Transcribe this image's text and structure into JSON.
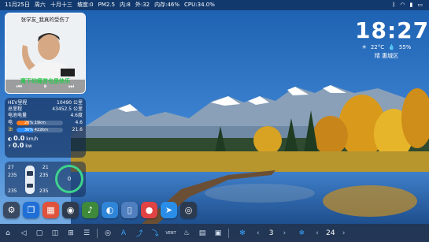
{
  "status_bar": {
    "date": "11月25日",
    "weekday": "周六",
    "lunar": "十月十三",
    "slope": "坡度:0",
    "pm25": "PM2.5",
    "inside": "内:8",
    "outside": "外:32",
    "memory": "内存:46%",
    "cpu": "CPU:34.0%",
    "icons": [
      "bluetooth-icon",
      "wifi-icon",
      "signal-icon",
      "battery-icon"
    ]
  },
  "clock": {
    "time": "18:27",
    "temperature": "22°C",
    "humidity": "55%",
    "location": "晴 惠城区"
  },
  "music": {
    "song_title": "张学友_我真的受伤了",
    "lyric": "离下的痛苦也是快乐",
    "controls": [
      "previous-icon",
      "pause-icon",
      "next-icon"
    ]
  },
  "vehicle": {
    "rows": [
      {
        "label": "HEV里程",
        "value": "10490 公里"
      },
      {
        "label": "总里程",
        "value": "43452.5 公里"
      },
      {
        "label": "电池电量",
        "value": "4.6度"
      }
    ],
    "electric": {
      "label": "电",
      "percent_text": "26% 19km",
      "percent": 26,
      "value": "4.6"
    },
    "fuel": {
      "label": "油",
      "percent_text": "36% 422km",
      "percent": 36,
      "value": "21.6"
    },
    "speed_label": "0.0",
    "speed_unit": "km/h",
    "energy_label": "0.0",
    "energy_unit": "kw",
    "accent_electric": "#ff7a1a",
    "accent_fuel": "#2b8cff"
  },
  "tires": {
    "front_left": "235",
    "front_right": "235",
    "rear_left": "235",
    "rear_right": "235",
    "temp_fl": "27",
    "temp_fr": "21",
    "gauge_value": "0",
    "gauge_color": "#3dd28c"
  },
  "dock": {
    "apps": [
      {
        "name": "settings-app",
        "glyph": "⚙",
        "color": "#3a4a63"
      },
      {
        "name": "copy-app",
        "glyph": "❐",
        "color": "#1f6fd6"
      },
      {
        "name": "gallery-app",
        "glyph": "▦",
        "color": "#e0523a"
      },
      {
        "name": "car-app",
        "glyph": "◉",
        "color": "#2e3b4e"
      },
      {
        "name": "music-app",
        "glyph": "♪",
        "color": "#3e8a3a"
      },
      {
        "name": "dashboard-app",
        "glyph": "◐",
        "color": "#2f86d8"
      },
      {
        "name": "phone-app",
        "glyph": "▯",
        "color": "#4f7fbf"
      },
      {
        "name": "maps-app",
        "glyph": "●",
        "color": "#e04343"
      },
      {
        "name": "navigation-app",
        "glyph": "➤",
        "color": "#2a8ee8"
      },
      {
        "name": "camera-app",
        "glyph": "◎",
        "color": "#2c3a4f"
      }
    ]
  },
  "bottom_bar": {
    "icons_left": [
      "home-icon",
      "back-icon",
      "recent-icon",
      "window-icon",
      "grid-icon",
      "apps-icon"
    ],
    "icons_mid": [
      "steering-icon",
      "mode-icon",
      "seat-icon",
      "fan-up-icon",
      "vent-icon",
      "defrost-icon",
      "rear-defrost-icon",
      "heat-icon"
    ],
    "fan_level": "3",
    "temperature_set": "24",
    "vent_text": "VENT"
  }
}
